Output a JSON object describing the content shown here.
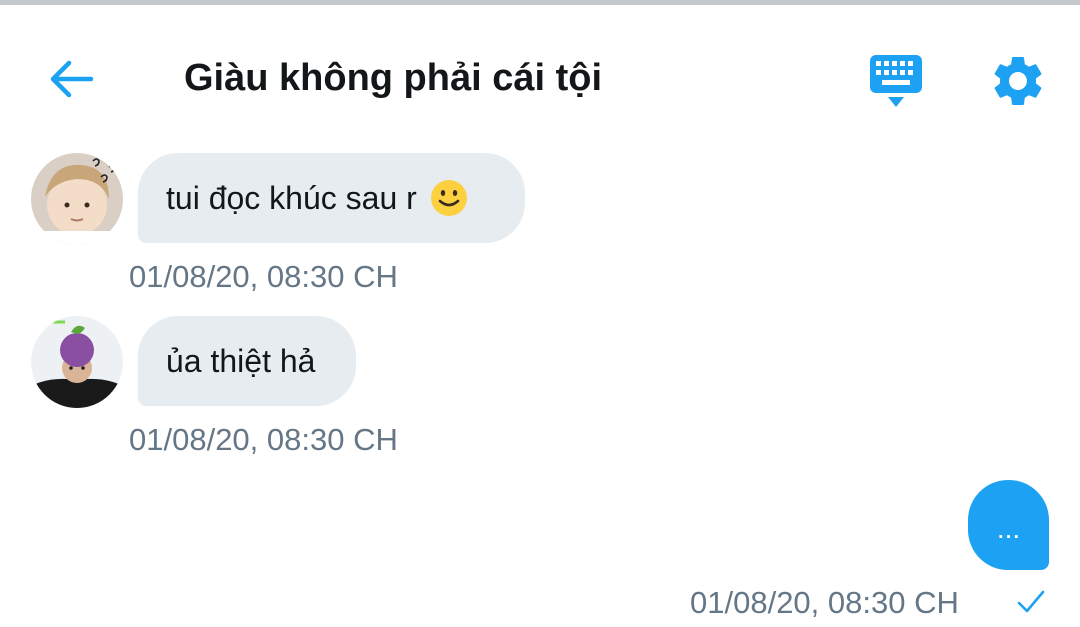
{
  "header": {
    "title": "Giàu không phải cái tội",
    "back_icon": "arrow-left-icon",
    "keyboard_icon": "keyboard-icon",
    "settings_icon": "gear-icon"
  },
  "messages": [
    {
      "direction": "incoming",
      "text": "tui đọc khúc sau r",
      "emoji": "slightly-smiling-face",
      "timestamp": "01/08/20, 08:30 CH"
    },
    {
      "direction": "incoming",
      "text": "ủa thiệt hả",
      "timestamp": "01/08/20, 08:30 CH"
    },
    {
      "direction": "outgoing",
      "text": "...",
      "timestamp": "01/08/20, 08:30 CH",
      "status_icon": "check-icon"
    }
  ],
  "colors": {
    "accent": "#1da1f2",
    "incoming_bubble": "#e6ecf0",
    "timestamp": "#657786",
    "title": "#14171a"
  }
}
